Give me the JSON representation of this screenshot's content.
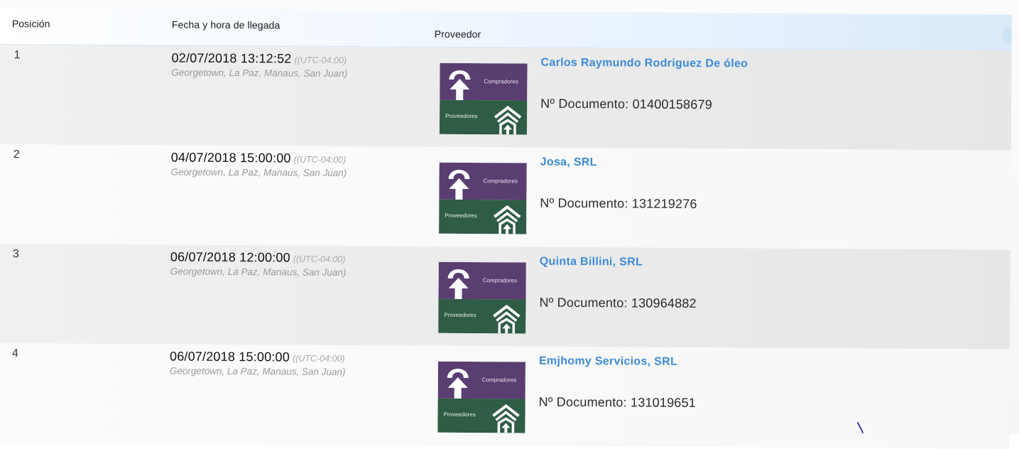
{
  "headers": {
    "position": "Posición",
    "arrival": "Fecha y hora de llegada",
    "supplier": "Proveedor"
  },
  "logo": {
    "top_label": "Compradores",
    "bottom_label": "Proveedores",
    "colors": {
      "top": "#5a3e71",
      "bottom": "#2f5c45"
    }
  },
  "rows": [
    {
      "position": "1",
      "datetime": "02/07/2018 13:12:52",
      "tz": "((UTC-04:00)",
      "zone": "Georgetown, La Paz, Manaus, San Juan)",
      "supplier": "Carlos Raymundo Rodriguez De óleo",
      "document": "Nº Documento: 01400158679"
    },
    {
      "position": "2",
      "datetime": "04/07/2018 15:00:00",
      "tz": "((UTC-04:00)",
      "zone": "Georgetown, La Paz, Manaus, San Juan)",
      "supplier": "Josa, SRL",
      "document": "Nº Documento: 131219276"
    },
    {
      "position": "3",
      "datetime": "06/07/2018 12:00:00",
      "tz": "((UTC-04:00)",
      "zone": "Georgetown, La Paz, Manaus, San Juan)",
      "supplier": "Quinta Billini, SRL",
      "document": "Nº Documento: 130964882"
    },
    {
      "position": "4",
      "datetime": "06/07/2018 15:00:00",
      "tz": "((UTC-04:00)",
      "zone": "Georgetown, La Paz, Manaus, San Juan)",
      "supplier": "Emjhomy Servicios, SRL",
      "document": "Nº Documento: 131019651"
    }
  ],
  "colors": {
    "supplier_link": "#3d8bd6",
    "header_gradient_end": "#dbeaf9"
  }
}
